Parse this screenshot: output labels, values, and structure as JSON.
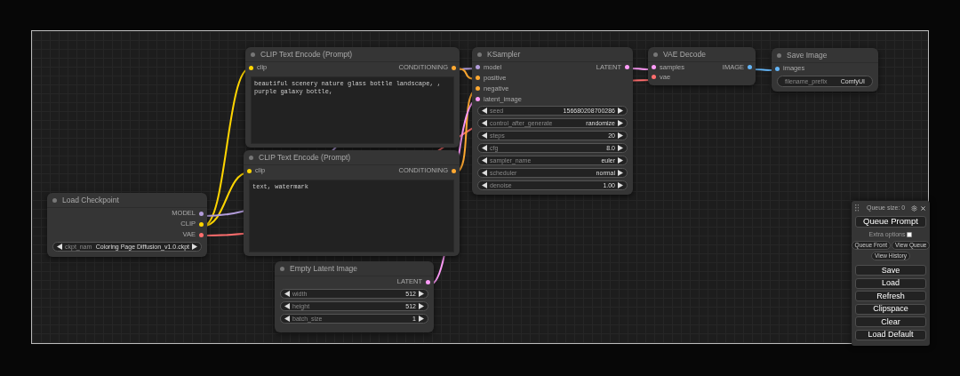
{
  "nodes": [
    {
      "title": "CLIP Text Encode (Prompt)",
      "inputs": [
        {
          "label": "clip",
          "color": "#ffd500"
        }
      ],
      "outputs": [
        {
          "label": "CONDITIONING",
          "color": "#ffa931"
        }
      ],
      "text": "beautiful scenery nature glass bottle landscape, , purple galaxy bottle,"
    },
    {
      "title": "CLIP Text Encode (Prompt)",
      "inputs": [
        {
          "label": "clip",
          "color": "#ffd500"
        }
      ],
      "outputs": [
        {
          "label": "CONDITIONING",
          "color": "#ffa931"
        }
      ],
      "text": "text, watermark"
    },
    {
      "title": "KSampler",
      "inputs": [
        {
          "label": "model",
          "color": "#b39ddb"
        },
        {
          "label": "positive",
          "color": "#ffa931"
        },
        {
          "label": "negative",
          "color": "#ffa931"
        },
        {
          "label": "latent_image",
          "color": "#ff9cf9"
        }
      ],
      "outputs": [
        {
          "label": "LATENT",
          "color": "#ff9cf9"
        }
      ],
      "widgets": [
        {
          "kind": "stepper",
          "name": "seed",
          "value": "156680208700286"
        },
        {
          "kind": "stepper",
          "name": "control_after_generate",
          "value": "randomize"
        },
        {
          "kind": "stepper",
          "name": "steps",
          "value": "20"
        },
        {
          "kind": "stepper",
          "name": "cfg",
          "value": "8.0"
        },
        {
          "kind": "stepper",
          "name": "sampler_name",
          "value": "euler"
        },
        {
          "kind": "stepper",
          "name": "scheduler",
          "value": "normal"
        },
        {
          "kind": "stepper",
          "name": "denoise",
          "value": "1.00"
        }
      ]
    },
    {
      "title": "VAE Decode",
      "inputs": [
        {
          "label": "samples",
          "color": "#ff9cf9"
        },
        {
          "label": "vae",
          "color": "#ff6e6e"
        }
      ],
      "outputs": [
        {
          "label": "IMAGE",
          "color": "#64b5f6"
        }
      ]
    },
    {
      "title": "Save Image",
      "inputs": [
        {
          "label": "images",
          "color": "#64b5f6"
        }
      ],
      "widgets": [
        {
          "kind": "text",
          "name": "filename_prefix",
          "value": "ComfyUI"
        }
      ]
    },
    {
      "title": "Load Checkpoint",
      "outputs": [
        {
          "label": "MODEL",
          "color": "#b39ddb"
        },
        {
          "label": "CLIP",
          "color": "#ffd500"
        },
        {
          "label": "VAE",
          "color": "#ff6e6e"
        }
      ],
      "widgets": [
        {
          "kind": "stepper",
          "name": "ckpt_nam",
          "value": "Coloring Page Diffusion_v1.0.ckpt"
        }
      ]
    },
    {
      "title": "Empty Latent Image",
      "outputs": [
        {
          "label": "LATENT",
          "color": "#ff9cf9"
        }
      ],
      "widgets": [
        {
          "kind": "stepper",
          "name": "width",
          "value": "512"
        },
        {
          "kind": "stepper",
          "name": "height",
          "value": "512"
        },
        {
          "kind": "stepper",
          "name": "batch_size",
          "value": "1"
        }
      ]
    }
  ],
  "queue_panel": {
    "queue_size": "Queue size: 0",
    "queue_button": "Queue Prompt",
    "extra_options": {
      "label": "Extra options",
      "checked": false
    },
    "small_buttons": [
      "Queue Front",
      "View Queue"
    ],
    "history_button": "View History",
    "buttons": [
      "Save",
      "Load",
      "Refresh",
      "Clipspace",
      "Clear",
      "Load Default"
    ]
  }
}
